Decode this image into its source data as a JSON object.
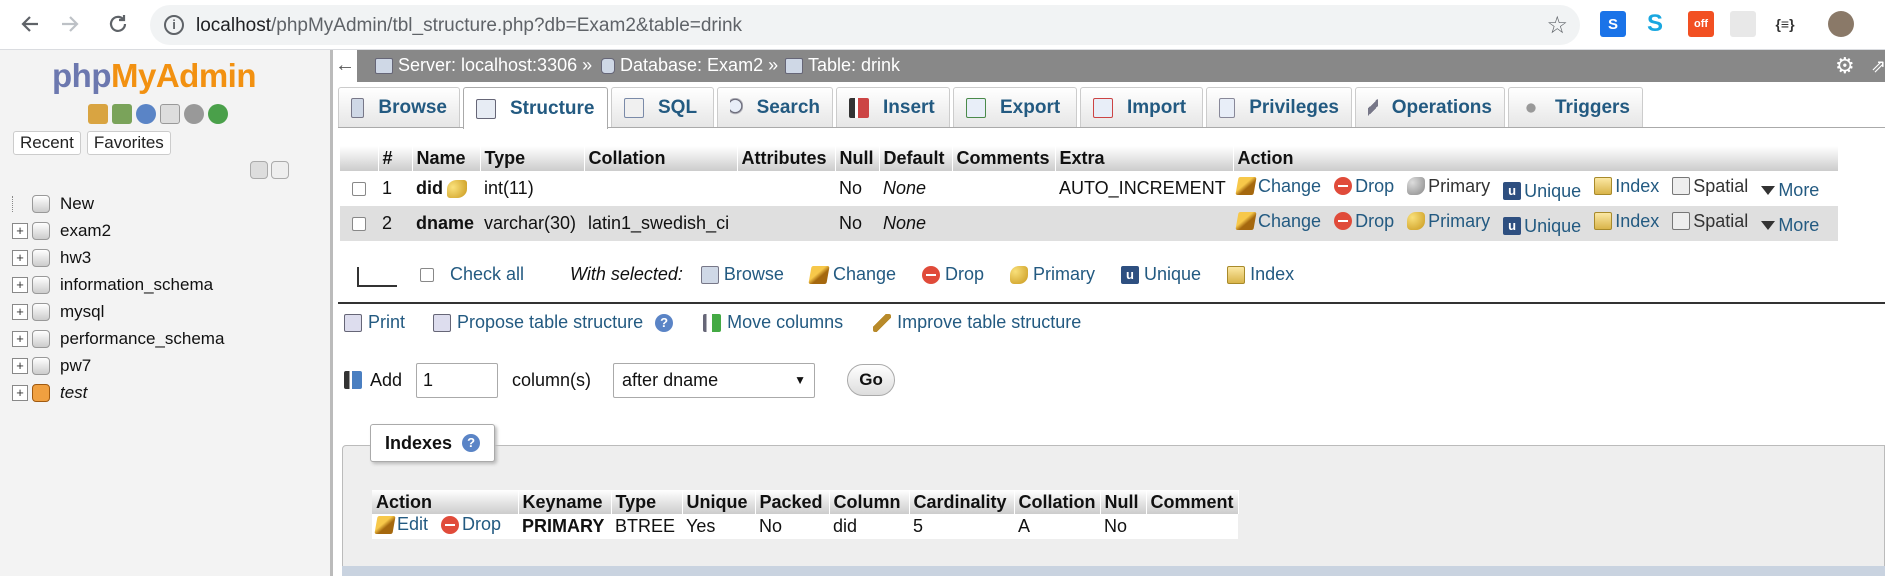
{
  "browser": {
    "url_host": "localhost",
    "url_path": "/phpMyAdmin/tbl_structure.php?db=Exam2&table=drink"
  },
  "sidebar": {
    "logo_php": "php",
    "logo_my": "My",
    "logo_admin": "Admin",
    "recent_label": "Recent",
    "favorites_label": "Favorites",
    "tree": [
      {
        "label": "New",
        "italic": false
      },
      {
        "label": "exam2",
        "italic": false
      },
      {
        "label": "hw3",
        "italic": false
      },
      {
        "label": "information_schema",
        "italic": false
      },
      {
        "label": "mysql",
        "italic": false
      },
      {
        "label": "performance_schema",
        "italic": false
      },
      {
        "label": "pw7",
        "italic": false
      },
      {
        "label": "test",
        "italic": true
      }
    ]
  },
  "breadcrumb": {
    "server": "Server: localhost:3306 »",
    "database": "Database: Exam2 »",
    "table": "Table: drink"
  },
  "tabs": [
    "Browse",
    "Structure",
    "SQL",
    "Search",
    "Insert",
    "Export",
    "Import",
    "Privileges",
    "Operations",
    "Triggers"
  ],
  "structure": {
    "headers": [
      "#",
      "Name",
      "Type",
      "Collation",
      "Attributes",
      "Null",
      "Default",
      "Comments",
      "Extra",
      "Action"
    ],
    "rows": [
      {
        "num": "1",
        "name": "did",
        "type": "int(11)",
        "collation": "",
        "attributes": "",
        "null": "No",
        "default": "None",
        "comments": "",
        "extra": "AUTO_INCREMENT"
      },
      {
        "num": "2",
        "name": "dname",
        "type": "varchar(30)",
        "collation": "latin1_swedish_ci",
        "attributes": "",
        "null": "No",
        "default": "None",
        "comments": "",
        "extra": ""
      }
    ],
    "actions": {
      "change": "Change",
      "drop": "Drop",
      "primary": "Primary",
      "unique": "Unique",
      "index": "Index",
      "spatial": "Spatial",
      "more": "More"
    }
  },
  "with_selected": {
    "check_all": "Check all",
    "label": "With selected:",
    "browse": "Browse",
    "change": "Change",
    "drop": "Drop",
    "primary": "Primary",
    "unique": "Unique",
    "index": "Index"
  },
  "links": {
    "print": "Print",
    "propose": "Propose table structure",
    "move": "Move columns",
    "improve": "Improve table structure"
  },
  "add_columns": {
    "add_label": "Add",
    "count": "1",
    "columns_label": "column(s)",
    "position": "after dname",
    "go": "Go"
  },
  "indexes": {
    "legend": "Indexes",
    "headers": [
      "Action",
      "Keyname",
      "Type",
      "Unique",
      "Packed",
      "Column",
      "Cardinality",
      "Collation",
      "Null",
      "Comment"
    ],
    "edit": "Edit",
    "drop": "Drop",
    "row": {
      "keyname": "PRIMARY",
      "type": "BTREE",
      "unique": "Yes",
      "packed": "No",
      "column": "did",
      "cardinality": "5",
      "collation": "A",
      "null": "No",
      "comment": ""
    }
  }
}
